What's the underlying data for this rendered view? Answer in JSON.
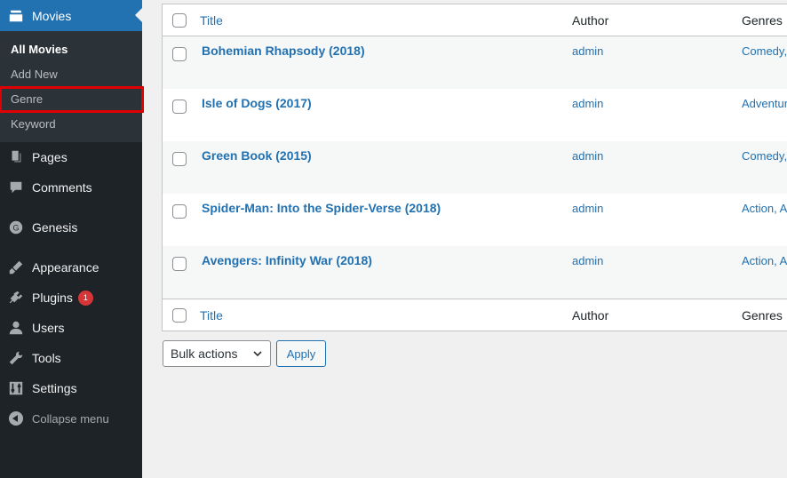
{
  "sidebar": {
    "movies_label": "Movies",
    "submenu": [
      "All Movies",
      "Add New",
      "Genre",
      "Keyword"
    ],
    "menu": {
      "pages": "Pages",
      "comments": "Comments",
      "genesis": "Genesis",
      "appearance": "Appearance",
      "plugins": "Plugins",
      "plugins_badge": "1",
      "users": "Users",
      "tools": "Tools",
      "settings": "Settings",
      "collapse": "Collapse menu"
    },
    "highlight_color": "#e00000"
  },
  "table": {
    "columns": {
      "title": "Title",
      "author": "Author",
      "genres": "Genres"
    },
    "rows": [
      {
        "title": "Bohemian Rhapsody (2018)",
        "author": "admin",
        "genres": "Comedy,"
      },
      {
        "title": "Isle of Dogs (2017)",
        "author": "admin",
        "genres": "Adventur"
      },
      {
        "title": "Green Book (2015)",
        "author": "admin",
        "genres": "Comedy,"
      },
      {
        "title": "Spider-Man: Into the Spider-Verse (2018)",
        "author": "admin",
        "genres": "Action, A"
      },
      {
        "title": "Avengers: Infinity War (2018)",
        "author": "admin",
        "genres": "Action, A"
      }
    ]
  },
  "bulk": {
    "select_value": "Bulk actions",
    "apply_label": "Apply"
  },
  "colors": {
    "accent": "#2271b1",
    "sidebar_bg": "#1d2327",
    "submenu_bg": "#2c3338"
  }
}
